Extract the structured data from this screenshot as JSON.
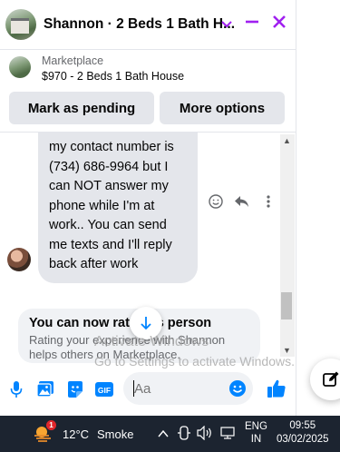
{
  "header": {
    "title": "Shannon · 2 Beds 1 Bath H...",
    "icons": [
      "chevron-down-icon",
      "minimize-icon",
      "close-icon"
    ],
    "accent": "#a020f0"
  },
  "listing": {
    "source": "Marketplace",
    "title": "$970 - 2 Beds 1 Bath House"
  },
  "actions": {
    "pending_label": "Mark as pending",
    "more_label": "More options"
  },
  "message": {
    "lines": [
      "my contact number is",
      "(734) 686-9964 but I",
      "can NOT answer my",
      "phone while I'm at",
      "work.. You can send",
      "me texts and I'll reply",
      "back after work"
    ]
  },
  "rate_card": {
    "title": "You can now rate this person",
    "text": "Rating your experience with Shannon helps others on Marketplace."
  },
  "watermark": {
    "line1": "Activate Windows",
    "line2": "Go to Settings to activate Windows."
  },
  "composer": {
    "placeholder": "Aa",
    "accent": "#0084ff"
  },
  "taskbar": {
    "temperature": "12°C",
    "weather": "Smoke",
    "weather_badge": "1",
    "lang_line1": "ENG",
    "lang_line2": "IN",
    "time": "09:55",
    "date": "03/02/2025"
  }
}
